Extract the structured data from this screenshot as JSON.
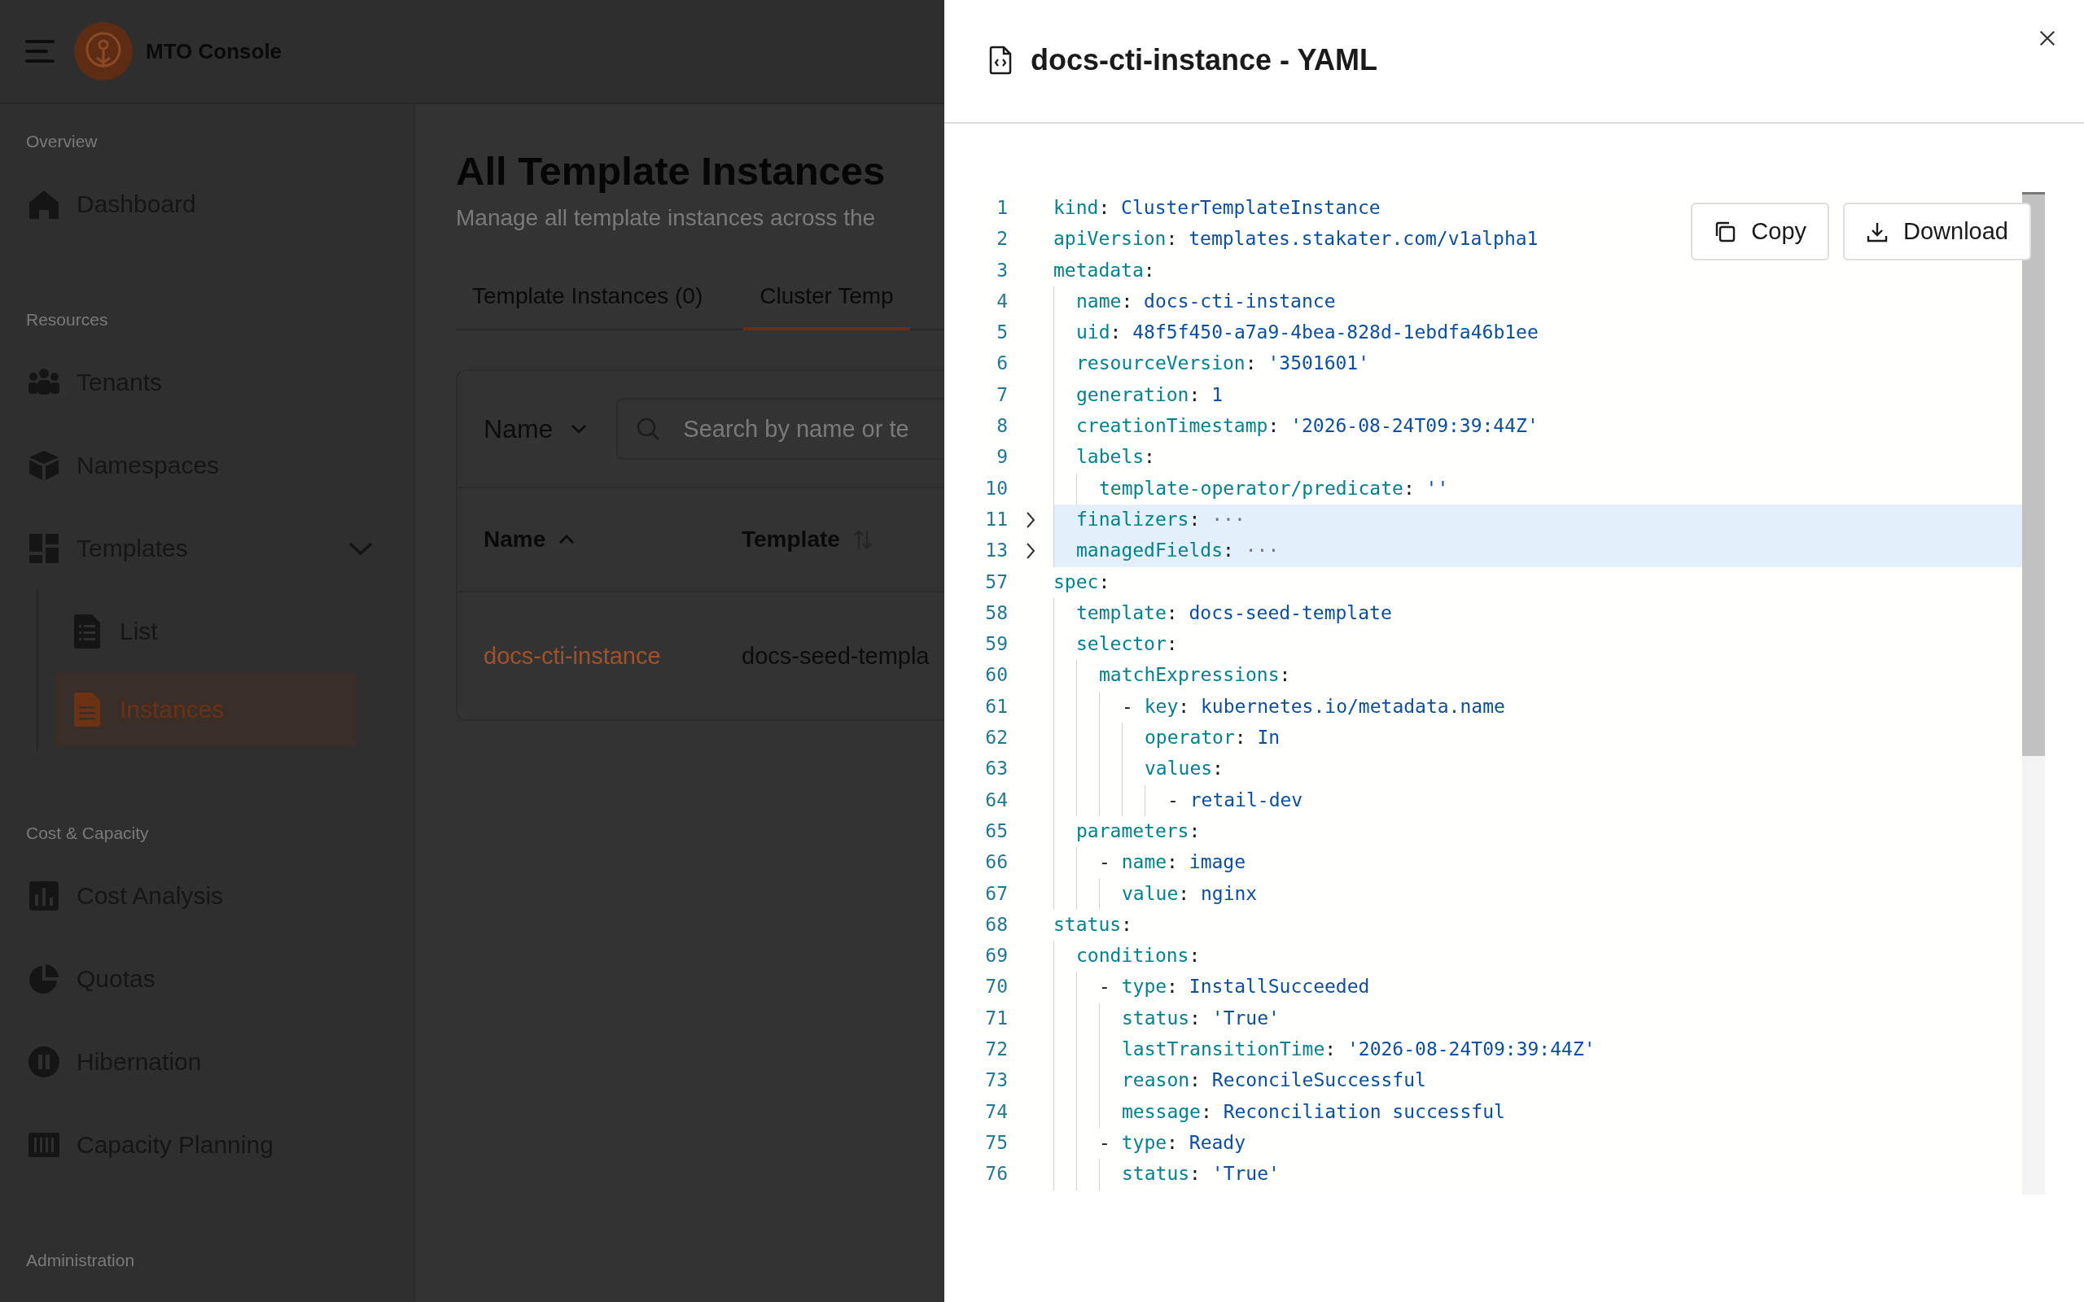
{
  "app": {
    "title": "MTO Console"
  },
  "sidebar": {
    "sections": [
      {
        "label": "Overview",
        "items": [
          {
            "label": "Dashboard",
            "selected": false
          }
        ]
      },
      {
        "label": "Resources",
        "items": [
          {
            "label": "Tenants",
            "selected": false
          },
          {
            "label": "Namespaces",
            "selected": false
          },
          {
            "label": "Templates",
            "selected": false,
            "expanded": true,
            "children": [
              {
                "label": "List",
                "selected": false
              },
              {
                "label": "Instances",
                "selected": true
              }
            ]
          }
        ]
      },
      {
        "label": "Cost & Capacity",
        "items": [
          {
            "label": "Cost Analysis",
            "selected": false
          },
          {
            "label": "Quotas",
            "selected": false
          },
          {
            "label": "Hibernation",
            "selected": false
          },
          {
            "label": "Capacity Planning",
            "selected": false
          }
        ]
      },
      {
        "label": "Administration"
      }
    ]
  },
  "page": {
    "title": "All Template Instances",
    "subtitle": "Manage all template instances across the",
    "tabs": [
      {
        "label": "Template Instances (0)",
        "selected": false
      },
      {
        "label": "Cluster Temp",
        "selected": true
      }
    ],
    "filter": {
      "field": "Name",
      "placeholder": "Search by name or te"
    },
    "table": {
      "columns": [
        {
          "label": "Name",
          "sorted": true
        },
        {
          "label": "Template",
          "sorted": false
        }
      ],
      "rows": [
        [
          "docs-cti-instance",
          "docs-seed-templa"
        ]
      ]
    }
  },
  "drawer": {
    "title": "docs-cti-instance - YAML",
    "actions": [
      "Copy",
      "Download"
    ],
    "code": [
      {
        "num": "1",
        "key": "kind:",
        "value": "ClusterTemplateInstance"
      },
      {
        "num": "2",
        "key": "apiVersion:",
        "value": "templates.stakater.com/v1alpha1"
      },
      {
        "num": "3",
        "key": "metadata:",
        "children": [
          {
            "num": "4",
            "key": "name:",
            "value": "docs-cti-instance"
          },
          {
            "num": "5",
            "key": "uid:",
            "value": "48f5f450-a7a9-4bea-828d-1ebdfa46b1ee"
          },
          {
            "num": "6",
            "key": "resourceVersion:",
            "value": "'3501601'"
          },
          {
            "num": "7",
            "key": "generation:",
            "value": "1"
          },
          {
            "num": "8",
            "key": "creationTimestamp:",
            "value": "'2026-08-24T09:39:44Z'"
          },
          {
            "num": "9",
            "key": "labels:",
            "children": [
              {
                "num": "10",
                "key": "template-operator/predicate:",
                "value": "''"
              }
            ]
          },
          {
            "num": "11",
            "key": "finalizers:",
            "value": "···",
            "expanded": false
          },
          {
            "num": "13",
            "key": "managedFields:",
            "value": "···",
            "expanded": false
          }
        ]
      },
      {
        "num": "57",
        "key": "spec:",
        "children": [
          {
            "num": "58",
            "key": "template:",
            "value": "docs-seed-template"
          },
          {
            "num": "59",
            "key": "selector:",
            "children": [
              {
                "num": "60",
                "key": "matchExpressions:",
                "children": [
                  {
                    "num": "61",
                    "dash": "-",
                    "key": "key:",
                    "value": "kubernetes.io/metadata.name",
                    "children": [
                      {
                        "num": "62",
                        "key": "operator:",
                        "value": "In"
                      },
                      {
                        "num": "63",
                        "key": "values:",
                        "children": [
                          {
                            "num": "64",
                            "dash": "-",
                            "value": "retail-dev"
                          }
                        ]
                      }
                    ]
                  }
                ]
              }
            ]
          },
          {
            "num": "65",
            "key": "parameters:",
            "children": [
              {
                "num": "66",
                "dash": "-",
                "key": "name:",
                "value": "image",
                "children": [
                  {
                    "num": "67",
                    "key": "value:",
                    "value": "nginx"
                  }
                ]
              }
            ]
          }
        ]
      },
      {
        "num": "68",
        "key": "status:",
        "children": [
          {
            "num": "69",
            "key": "conditions:",
            "children": [
              {
                "num": "70",
                "dash": "-",
                "key": "type:",
                "value": "InstallSucceeded",
                "children": [
                  {
                    "num": "71",
                    "key": "status:",
                    "value": "'True'"
                  },
                  {
                    "num": "72",
                    "key": "lastTransitionTime:",
                    "value": "'2026-08-24T09:39:44Z'"
                  },
                  {
                    "num": "73",
                    "key": "reason:",
                    "value": "ReconcileSuccessful"
                  },
                  {
                    "num": "74",
                    "key": "message:",
                    "value": "Reconciliation successful"
                  }
                ]
              },
              {
                "num": "75",
                "dash": "-",
                "key": "type:",
                "value": "Ready",
                "children": [
                  {
                    "num": "76",
                    "key": "status:",
                    "value": "'True'"
                  }
                ]
              }
            ]
          }
        ]
      }
    ]
  }
}
